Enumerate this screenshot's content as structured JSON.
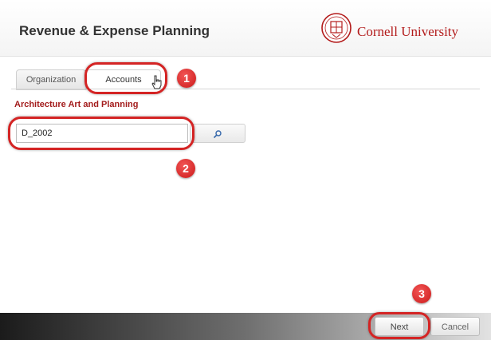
{
  "header": {
    "title": "Revenue & Expense Planning",
    "brand": "Cornell University",
    "brand_color": "#b31b1b"
  },
  "tabs": [
    {
      "label": "Organization",
      "selected": false
    },
    {
      "label": "Accounts",
      "selected": true
    }
  ],
  "department": "Architecture Art and Planning",
  "search": {
    "value": "D_2002",
    "button_icon": "search-icon"
  },
  "annotations": {
    "step1": "1",
    "step2": "2",
    "step3": "3",
    "highlight_color": "#d42424"
  },
  "footer": {
    "next_label": "Next",
    "cancel_label": "Cancel"
  }
}
